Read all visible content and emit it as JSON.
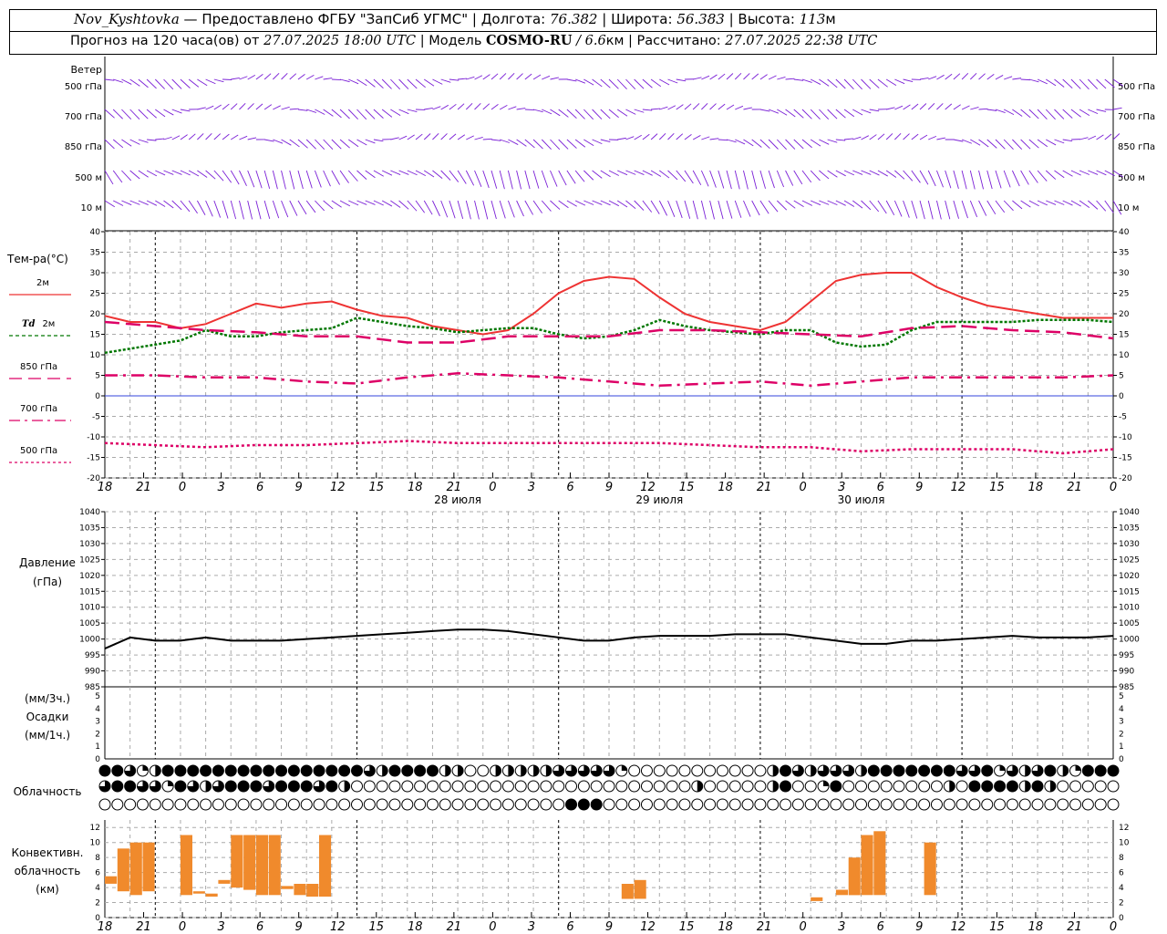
{
  "header": {
    "station": "Nov_Kyshtovka",
    "provider_sep": " — Предоставлено ФГБУ \"ЗапСиб УГМС\" | Долгота: ",
    "lon": "76.382",
    "lat_label": " | Широта: ",
    "lat": "56.383",
    "alt_label": " | Высота: ",
    "alt": "113",
    "alt_unit": "м",
    "forecast_prefix": "Прогноз на 120 часа(ов) от ",
    "forecast_from": "27.07.2025 18:00 UTC",
    "model_label": " | Модель ",
    "model": "COSMO-RU",
    "model_res": " / 6.6",
    "model_res_unit": "км",
    "calc_label": " | Рассчитано: ",
    "calc_time": "27.07.2025 22:38 UTC"
  },
  "panels": {
    "wind": {
      "title": "Ветер",
      "levels": [
        "500 гПа",
        "700 гПа",
        "850 гПа",
        "500 м",
        "10 м"
      ]
    },
    "temp": {
      "title": "Тем-ра(°C)",
      "legend": [
        {
          "prefix": "",
          "label": "2м",
          "color": "#ee3333",
          "dash": ""
        },
        {
          "prefix": "Td",
          "label": "2м",
          "color": "#007700",
          "dash": "4,3"
        },
        {
          "prefix": "",
          "label": "850 гПа",
          "color": "#dd0066",
          "dash": "14,7"
        },
        {
          "prefix": "",
          "label": "700 гПа",
          "color": "#dd0066",
          "dash": "12,5,3,5"
        },
        {
          "prefix": "",
          "label": "500 гПа",
          "color": "#dd0066",
          "dash": "3,3"
        }
      ]
    },
    "pressure": {
      "title": "Давление",
      "unit": "(гПа)"
    },
    "precip": {
      "unit_top": "(мм/3ч.)",
      "title": "Осадки",
      "unit_bottom": "(мм/1ч.)"
    },
    "cloud": {
      "title": "Облачность"
    },
    "convective": {
      "title_1": "Конвективн.",
      "title_2": "облачность",
      "unit": "(км)"
    }
  },
  "axis": {
    "hour_ticks": [
      "18",
      "21",
      "0",
      "3",
      "6",
      "9",
      "12",
      "15",
      "18",
      "21",
      "0",
      "3",
      "6",
      "9",
      "12",
      "15",
      "18",
      "21",
      "0",
      "3",
      "6",
      "9",
      "12",
      "15",
      "18",
      "21",
      "0"
    ],
    "dates": [
      "28 июля",
      "29 июля",
      "30 июля"
    ]
  },
  "chart_data": [
    {
      "type": "line",
      "title": "Тем-ра(°C)",
      "x_unit": "hours from 27.07.2025 18:00 UTC",
      "ylim": [
        -20,
        40
      ],
      "yticks": [
        -20,
        -15,
        -10,
        -5,
        0,
        5,
        10,
        15,
        20,
        25,
        30,
        35,
        40
      ],
      "series": [
        {
          "name": "2м",
          "x": [
            0,
            3,
            6,
            9,
            12,
            15,
            18,
            21,
            24,
            27,
            30,
            33,
            36,
            39,
            42,
            45,
            48,
            51,
            54,
            57,
            60,
            63,
            66,
            69,
            72,
            75,
            78,
            81,
            84,
            87,
            90,
            93,
            96,
            99,
            102,
            105,
            108,
            111,
            114,
            117,
            120
          ],
          "values": [
            19.5,
            18,
            18,
            16.5,
            17.5,
            20,
            22.5,
            21.5,
            22.5,
            23,
            21,
            19.5,
            19,
            17,
            16,
            15,
            16,
            20,
            25,
            28,
            29,
            28.5,
            24,
            20,
            18,
            17,
            16,
            18,
            23,
            28,
            29.5,
            30,
            30,
            26.5,
            24,
            22,
            21,
            20,
            19,
            19,
            19
          ]
        },
        {
          "name": "Td 2м",
          "x": [
            0,
            3,
            6,
            9,
            12,
            15,
            18,
            21,
            24,
            27,
            30,
            33,
            36,
            39,
            42,
            45,
            48,
            51,
            54,
            57,
            60,
            63,
            66,
            69,
            72,
            75,
            78,
            81,
            84,
            87,
            90,
            93,
            96,
            99,
            102,
            105,
            108,
            111,
            114,
            117,
            120
          ],
          "values": [
            10.5,
            11.5,
            12.5,
            13.5,
            16,
            14.5,
            14.5,
            15.5,
            16,
            16.5,
            19,
            18,
            17,
            16.5,
            15.5,
            16,
            16.5,
            16.5,
            15,
            14,
            14.5,
            16,
            18.5,
            17,
            16,
            15.5,
            15,
            16,
            16,
            13,
            12,
            12.5,
            16,
            18,
            18,
            18,
            18,
            18.5,
            18.5,
            18.5,
            18
          ]
        },
        {
          "name": "850 гПа",
          "x": [
            0,
            6,
            12,
            18,
            24,
            30,
            36,
            42,
            48,
            54,
            60,
            66,
            72,
            78,
            84,
            90,
            96,
            102,
            108,
            114,
            120
          ],
          "values": [
            18,
            17,
            16,
            15.5,
            14.5,
            14.5,
            13,
            13,
            14.5,
            14.5,
            14.5,
            16,
            16,
            15.5,
            15,
            14.5,
            16.5,
            17,
            16,
            15.5,
            14
          ]
        },
        {
          "name": "700 гПа",
          "x": [
            0,
            6,
            12,
            18,
            24,
            30,
            36,
            42,
            48,
            54,
            60,
            66,
            72,
            78,
            84,
            90,
            96,
            102,
            108,
            114,
            120
          ],
          "values": [
            5,
            5,
            4.5,
            4.5,
            3.5,
            3,
            4.5,
            5.5,
            5,
            4.5,
            3.5,
            2.5,
            3,
            3.5,
            2.5,
            3.5,
            4.5,
            4.5,
            4.5,
            4.5,
            5
          ]
        },
        {
          "name": "500 гПа",
          "x": [
            0,
            6,
            12,
            18,
            24,
            30,
            36,
            42,
            48,
            54,
            60,
            66,
            72,
            78,
            84,
            90,
            96,
            102,
            108,
            114,
            120
          ],
          "values": [
            -11.5,
            -12,
            -12.5,
            -12,
            -12,
            -11.5,
            -11,
            -11.5,
            -11.5,
            -11.5,
            -11.5,
            -11.5,
            -12,
            -12.5,
            -12.5,
            -13.5,
            -13,
            -13,
            -13,
            -14,
            -13
          ]
        }
      ]
    },
    {
      "type": "line",
      "title": "Давление",
      "ylabel": "(гПа)",
      "ylim": [
        985,
        1040
      ],
      "yticks": [
        985,
        990,
        995,
        1000,
        1005,
        1010,
        1015,
        1020,
        1025,
        1030,
        1035,
        1040
      ],
      "series": [
        {
          "x": [
            0,
            3,
            6,
            9,
            12,
            15,
            18,
            21,
            24,
            27,
            30,
            33,
            36,
            39,
            42,
            45,
            48,
            51,
            54,
            57,
            60,
            63,
            66,
            69,
            72,
            75,
            78,
            81,
            84,
            87,
            90,
            93,
            96,
            99,
            102,
            105,
            108,
            111,
            114,
            117,
            120
          ],
          "values": [
            997,
            1000.5,
            999.5,
            999.5,
            1000.5,
            999.5,
            999.5,
            999.5,
            1000,
            1000.5,
            1001,
            1001.5,
            1002,
            1002.5,
            1003,
            1003,
            1002.5,
            1001.5,
            1000.5,
            999.5,
            999.5,
            1000.5,
            1001,
            1001,
            1001,
            1001.5,
            1001.5,
            1001.5,
            1000.5,
            999.5,
            998.5,
            998.5,
            999.5,
            999.5,
            1000,
            1000.5,
            1001,
            1000.5,
            1000.5,
            1000.5,
            1001
          ]
        }
      ]
    },
    {
      "type": "bar",
      "title": "Осадки",
      "ylim": [
        0,
        5
      ],
      "yticks": [
        0,
        1,
        2,
        3,
        4,
        5
      ],
      "values": []
    },
    {
      "type": "bar",
      "title": "Конвективн. облачность",
      "ylabel": "(км)",
      "ylim": [
        0,
        13
      ],
      "yticks": [
        0,
        2,
        4,
        6,
        8,
        10,
        12
      ],
      "bars": [
        {
          "x": 0,
          "base": 4.5,
          "top": 5.5
        },
        {
          "x": 1,
          "base": 3.5,
          "top": 9.2
        },
        {
          "x": 2,
          "base": 3,
          "top": 10
        },
        {
          "x": 3,
          "base": 3.5,
          "top": 10
        },
        {
          "x": 6,
          "base": 3,
          "top": 11
        },
        {
          "x": 7,
          "base": 3.2,
          "top": 3.5
        },
        {
          "x": 8,
          "base": 2.8,
          "top": 3.2
        },
        {
          "x": 9,
          "base": 4.5,
          "top": 5
        },
        {
          "x": 10,
          "base": 4,
          "top": 11
        },
        {
          "x": 11,
          "base": 3.7,
          "top": 11
        },
        {
          "x": 12,
          "base": 3,
          "top": 11
        },
        {
          "x": 13,
          "base": 3,
          "top": 11
        },
        {
          "x": 14,
          "base": 3.8,
          "top": 4.2
        },
        {
          "x": 15,
          "base": 3,
          "top": 4.5
        },
        {
          "x": 16,
          "base": 2.8,
          "top": 4.5
        },
        {
          "x": 17,
          "base": 2.8,
          "top": 11
        },
        {
          "x": 41,
          "base": 2.5,
          "top": 4.5
        },
        {
          "x": 42,
          "base": 2.5,
          "top": 5
        },
        {
          "x": 56,
          "base": 2.2,
          "top": 2.7
        },
        {
          "x": 58,
          "base": 3,
          "top": 3.7
        },
        {
          "x": 59,
          "base": 3,
          "top": 8
        },
        {
          "x": 60,
          "base": 3,
          "top": 11
        },
        {
          "x": 61,
          "base": 3,
          "top": 11.5
        },
        {
          "x": 65,
          "base": 3,
          "top": 10
        }
      ]
    }
  ]
}
